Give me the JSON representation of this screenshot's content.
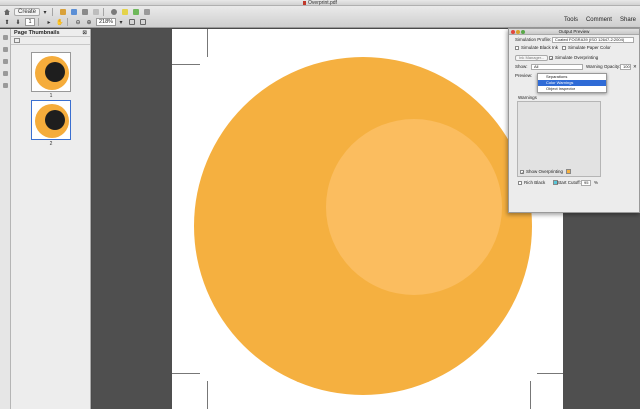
{
  "window": {
    "title": "Overprint.pdf"
  },
  "toolbar": {
    "create_label": "Create",
    "zoom_value": "218%",
    "page_value": "1",
    "right_tabs": [
      "Tools",
      "Comment",
      "Share"
    ]
  },
  "thumbnails": {
    "panel_title": "Page Thumbnails",
    "pages": [
      "1",
      "2"
    ]
  },
  "output_preview": {
    "title": "Output Preview",
    "simulation_profile_label": "Simulation Profile:",
    "simulation_profile_value": "Coated FOGRA39 (ISO 12647-2:2004)",
    "simulate_black_ink": "Simulate Black Ink",
    "simulate_paper_color": "Simulate Paper Color",
    "ink_manager": "Ink Manager...",
    "simulate_overprinting": "Simulate Overprinting",
    "show_label": "Show:",
    "show_value": "All",
    "warning_opacity_label": "Warning Opacity:",
    "warning_opacity_value": "100",
    "preview_label": "Preview:",
    "preview_options": [
      "Separations",
      "Color Warnings",
      "Object Inspector"
    ],
    "preview_selected": "Color Warnings",
    "warnings_label": "Warnings",
    "show_overprinting": "Show Overprinting",
    "rich_black": "Rich Black",
    "start_cutoff_label": "Start Cutoff:",
    "start_cutoff_value": "95",
    "percent": "%"
  },
  "colors": {
    "circle_outer": "#f5b040",
    "circle_inner": "#fbbd5f",
    "thumb_black": "#1e1e1e",
    "selection_blue": "#2f6bd6",
    "overprint_swatch": "#f5b040",
    "richblack_swatch": "#58c7d8"
  },
  "icons": [
    "home-icon",
    "open-icon",
    "save-icon",
    "print-icon",
    "email-icon",
    "comment-icon",
    "prev-page-icon",
    "next-page-icon",
    "select-icon",
    "hand-icon",
    "fit-icon",
    "fullscreen-icon"
  ]
}
